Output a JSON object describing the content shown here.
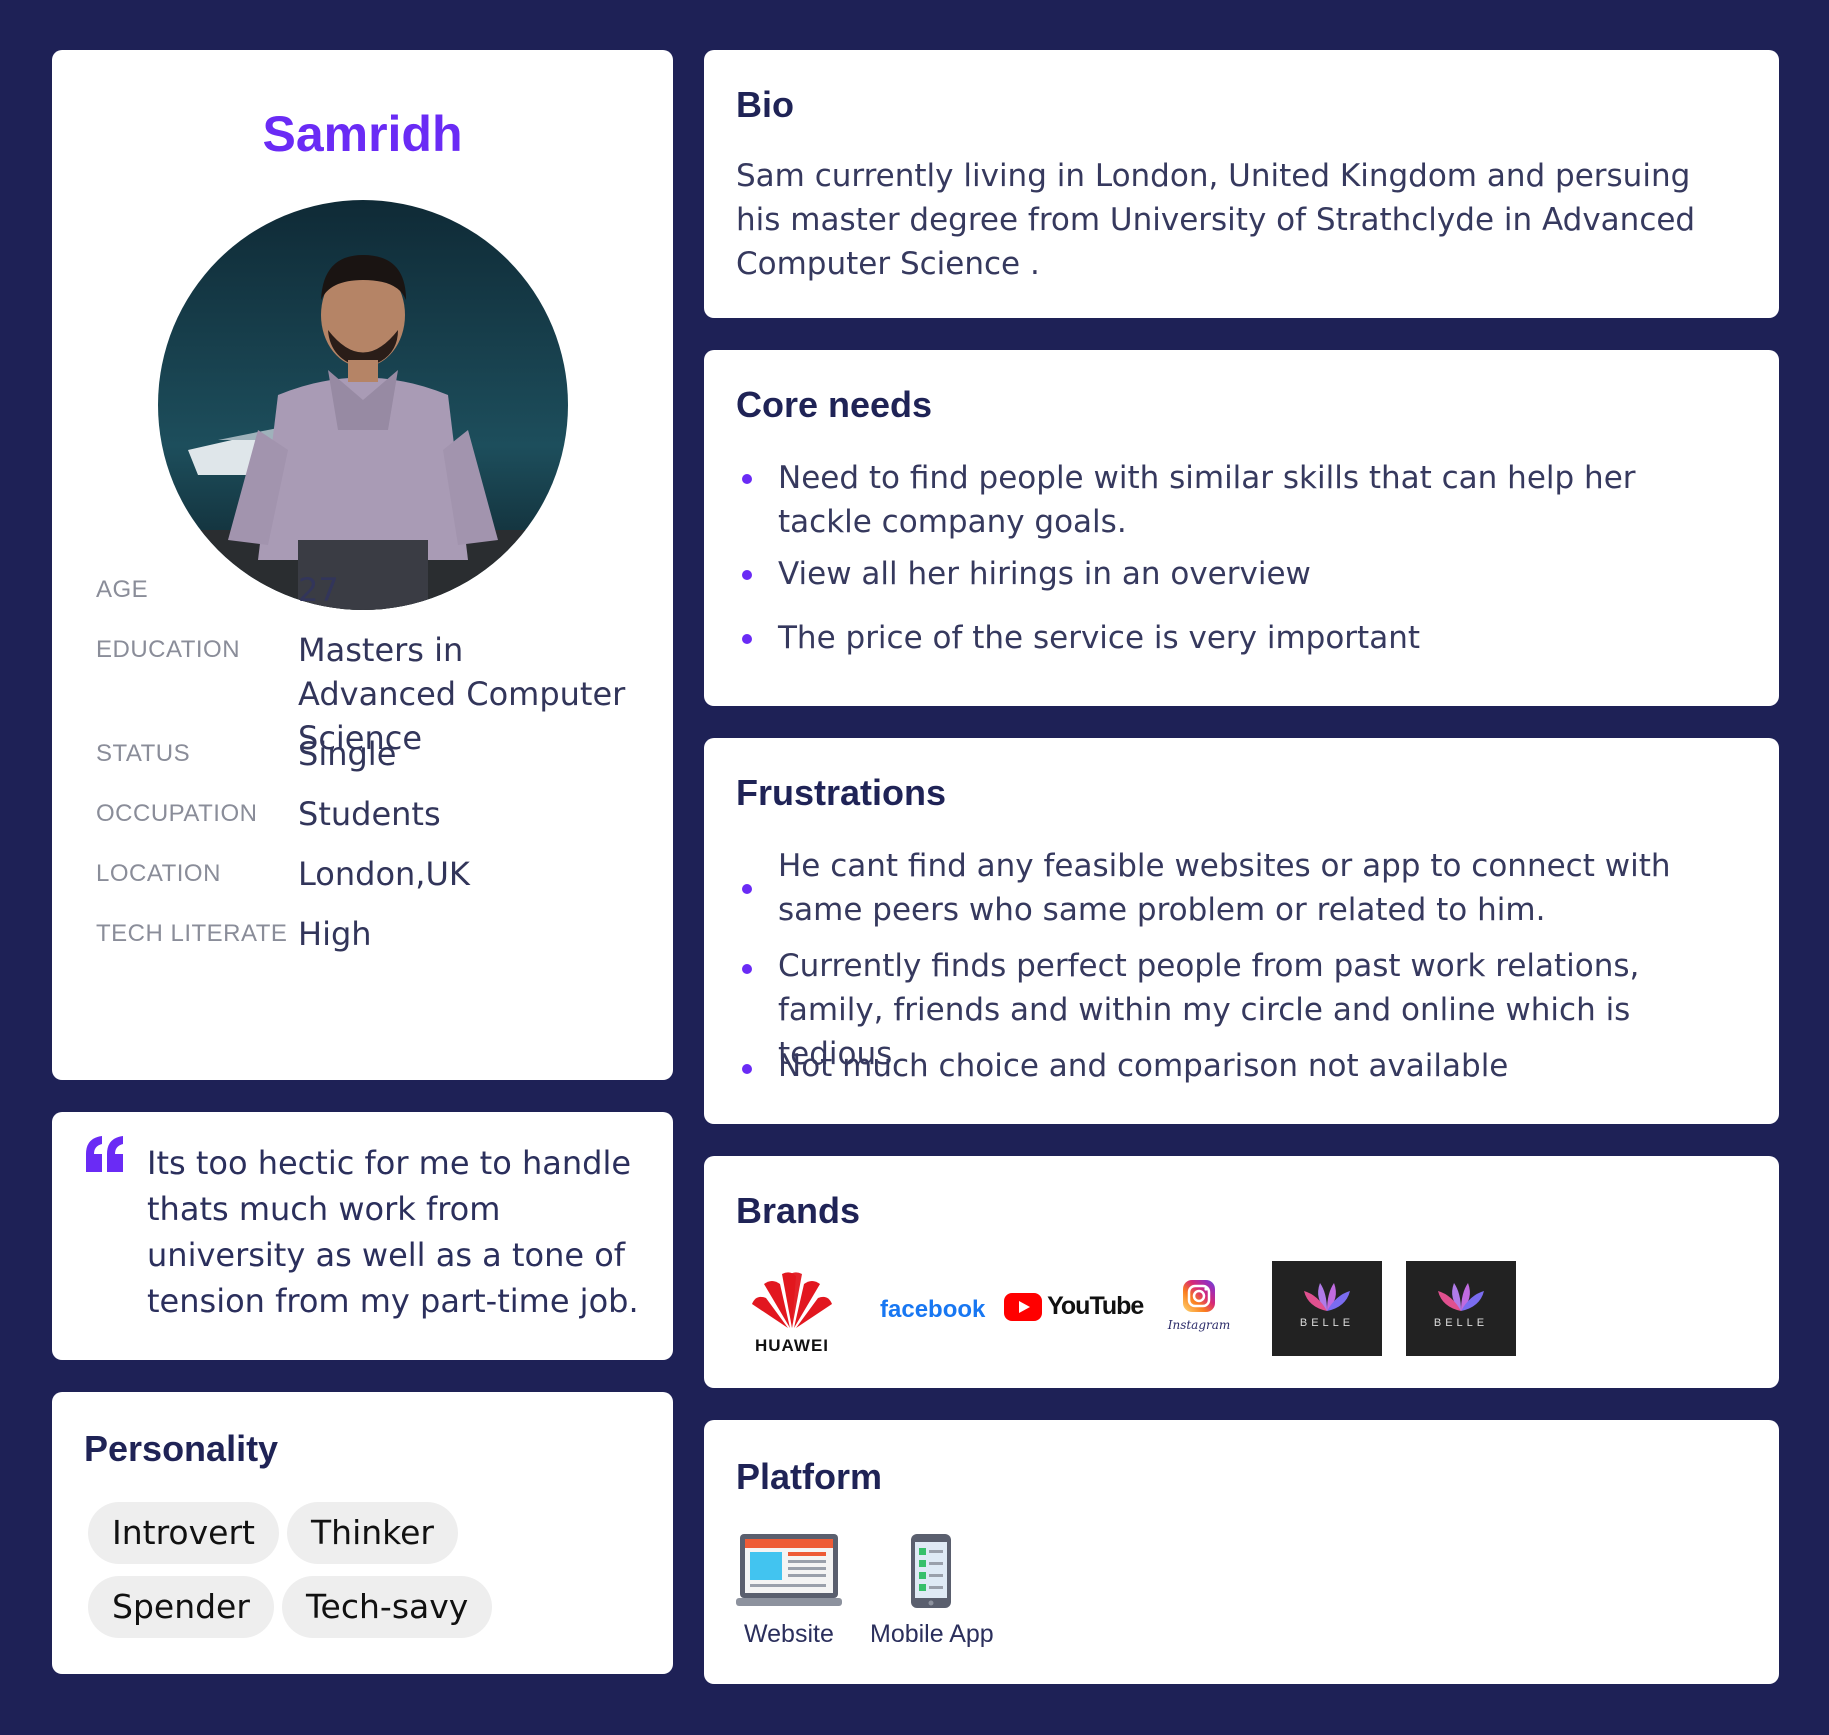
{
  "profile": {
    "name": "Samridh",
    "fields": [
      {
        "label": "AGE",
        "value": "27"
      },
      {
        "label": "EDUCATION",
        "value": "Masters in Advanced Computer Science"
      },
      {
        "label": "STATUS",
        "value": "Single"
      },
      {
        "label": "OCCUPATION",
        "value": "Students"
      },
      {
        "label": "LOCATION",
        "value": "London,UK"
      },
      {
        "label": "TECH  LITERATE",
        "value": "High"
      }
    ]
  },
  "quote": {
    "text": "Its too hectic for me to handle thats much work from university as well as a tone of tension from my part-time job."
  },
  "personality": {
    "title": "Personality",
    "tags": [
      "Introvert",
      "Thinker",
      "Spender",
      "Tech-savy"
    ]
  },
  "bio": {
    "title": "Bio",
    "text": "Sam currently living in London, United Kingdom and persuing his master degree  from University of Strathclyde in Advanced Computer Science ."
  },
  "core_needs": {
    "title": "Core needs",
    "items": [
      "Need to find people with similar skills that can help her tackle company goals.",
      "View all her hirings in an overview",
      "The price of the service is very important"
    ]
  },
  "frustrations": {
    "title": "Frustrations",
    "items": [
      "He cant find any feasible websites or app to connect with same peers who same problem or related to him.",
      "Currently finds perfect people from past work relations, family, friends and within my circle and online which is tedious",
      "Not much choice and comparison not available"
    ]
  },
  "brands": {
    "title": "Brands",
    "logos": [
      {
        "name": "huawei-logo",
        "text": "HUAWEI"
      },
      {
        "name": "facebook-logo",
        "text": "facebook"
      },
      {
        "name": "youtube-logo",
        "text": "YouTube"
      },
      {
        "name": "instagram-logo",
        "text": "Instagram"
      },
      {
        "name": "belle-logo",
        "text": "BELLE"
      },
      {
        "name": "belle-logo",
        "text": "BELLE"
      }
    ]
  },
  "platform": {
    "title": "Platform",
    "items": [
      {
        "label": "Website",
        "icon": "laptop-icon"
      },
      {
        "label": "Mobile App",
        "icon": "mobile-phone-icon"
      }
    ]
  },
  "colors": {
    "background": "#1e2156",
    "accent": "#6a2bf5",
    "heading": "#1f2356"
  }
}
